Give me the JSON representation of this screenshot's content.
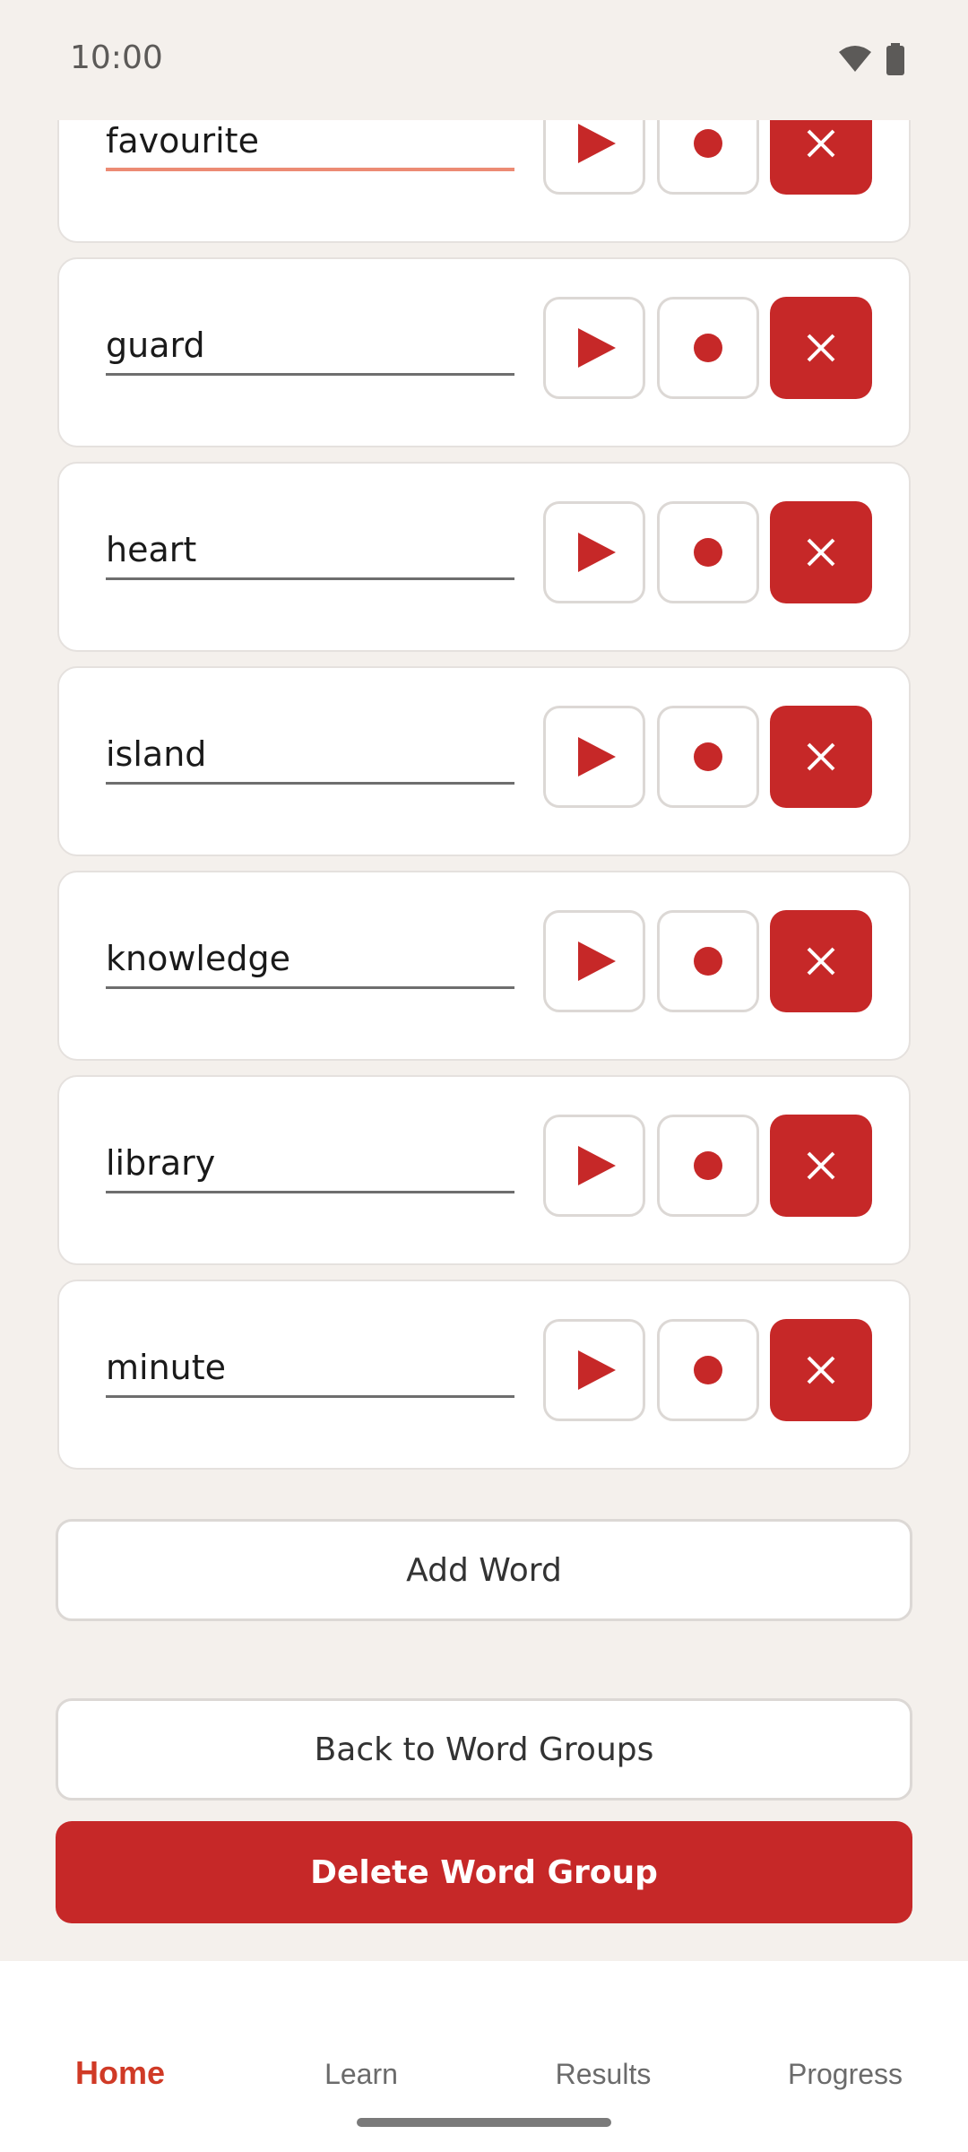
{
  "status": {
    "time": "10:00"
  },
  "words": [
    {
      "text": "favourite"
    },
    {
      "text": "guard"
    },
    {
      "text": "heart"
    },
    {
      "text": "island"
    },
    {
      "text": "knowledge"
    },
    {
      "text": "library"
    },
    {
      "text": "minute"
    }
  ],
  "actions": {
    "add_word": "Add Word",
    "back": "Back to Word Groups",
    "delete_group": "Delete Word Group"
  },
  "nav": {
    "items": [
      "Home",
      "Learn",
      "Results",
      "Progress"
    ],
    "active": "Home"
  },
  "icons": {
    "play": "play-icon",
    "record": "record-icon",
    "delete": "close-icon"
  },
  "colors": {
    "accent": "#c62828",
    "nav_active": "#d03a26",
    "background": "#f4f0ec",
    "focus_underline": "#ec8b74"
  }
}
